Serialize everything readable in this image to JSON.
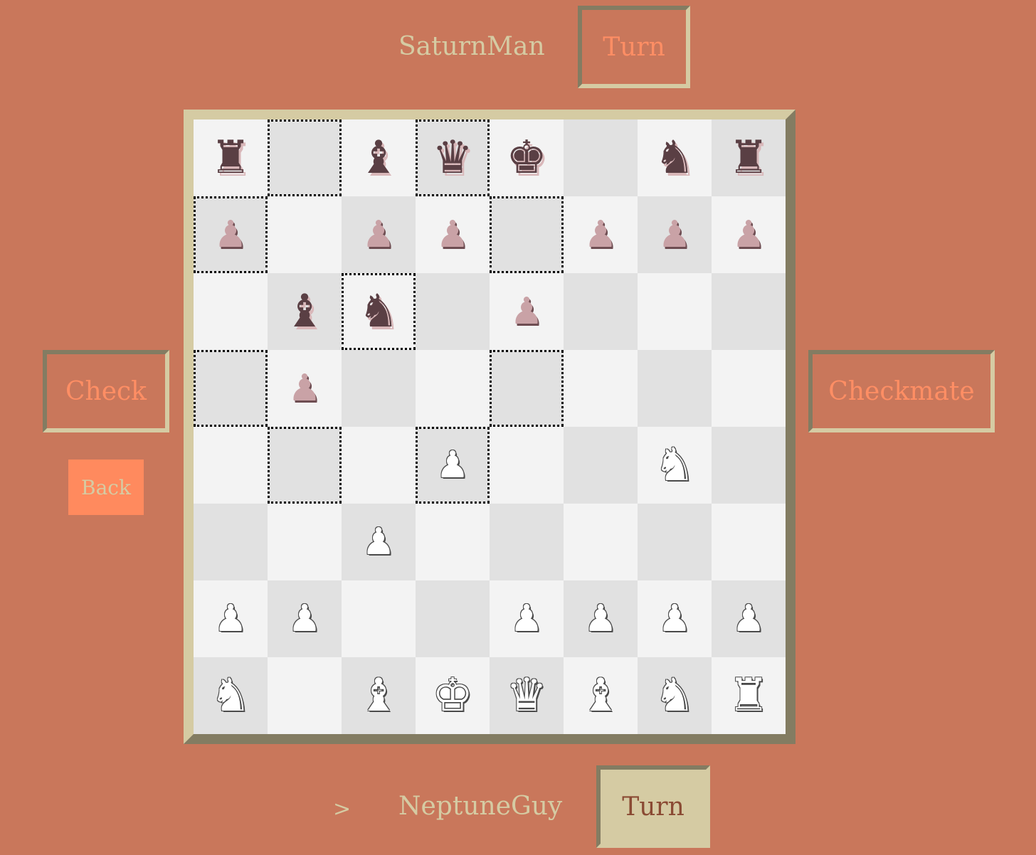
{
  "players": {
    "top": {
      "name": "SaturnMan",
      "turn_label": "Turn"
    },
    "bottom": {
      "name": "NeptuneGuy",
      "turn_label": "Turn",
      "indicator": ">"
    }
  },
  "buttons": {
    "check": "Check",
    "checkmate": "Checkmate",
    "back": "Back"
  },
  "board": {
    "rows": [
      [
        "bR",
        "",
        "bB",
        "bQ",
        "bK",
        "",
        "bN",
        "bR"
      ],
      [
        "bP",
        "",
        "bP",
        "bP",
        "",
        "bP",
        "bP",
        "bP"
      ],
      [
        "",
        "bB",
        "bN",
        "",
        "bP",
        "",
        "",
        ""
      ],
      [
        "",
        "bP",
        "",
        "",
        "",
        "",
        "",
        ""
      ],
      [
        "",
        "",
        "",
        "wP",
        "",
        "",
        "wN",
        ""
      ],
      [
        "",
        "",
        "wP",
        "",
        "",
        "",
        "",
        ""
      ],
      [
        "wP",
        "wP",
        "",
        "",
        "wP",
        "wP",
        "wP",
        "wP"
      ],
      [
        "wN",
        "",
        "wB",
        "wK",
        "wQ",
        "wB",
        "wN",
        "wR"
      ]
    ],
    "highlighted": [
      [
        0,
        1
      ],
      [
        0,
        3
      ],
      [
        1,
        0
      ],
      [
        1,
        4
      ],
      [
        2,
        2
      ],
      [
        3,
        0
      ],
      [
        3,
        4
      ],
      [
        4,
        1
      ],
      [
        4,
        3
      ]
    ]
  }
}
